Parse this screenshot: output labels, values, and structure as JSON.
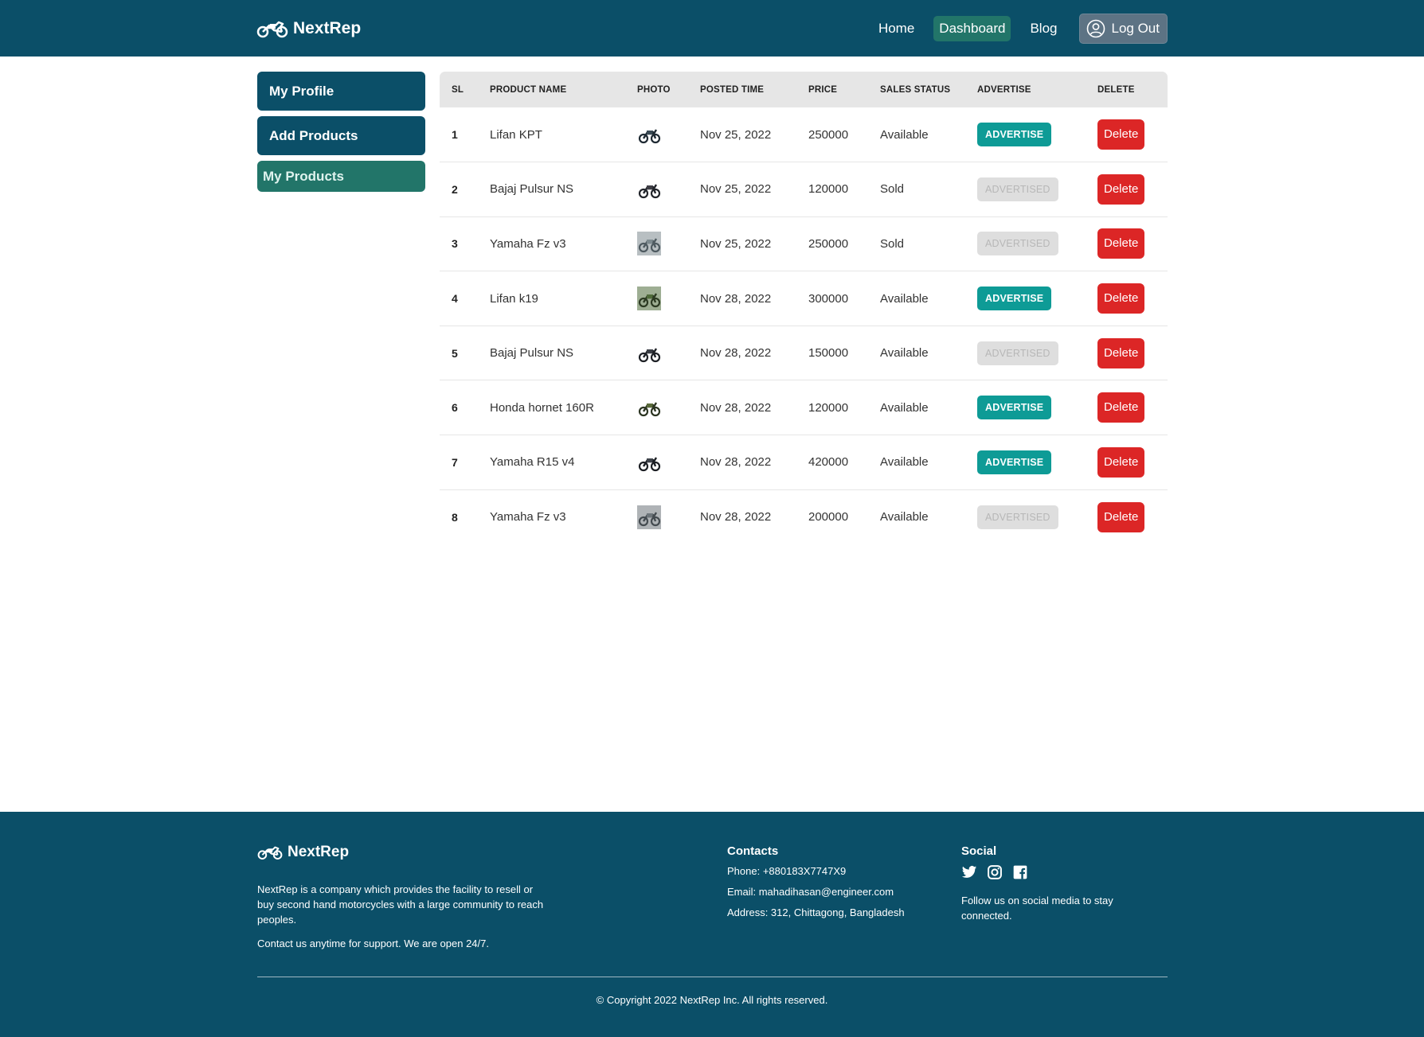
{
  "navbar": {
    "brand": "NextRep",
    "links": [
      "Home",
      "Dashboard",
      "Blog"
    ],
    "logout": "Log Out"
  },
  "sidebar": {
    "items": [
      "My Profile",
      "Add Products",
      "My Products"
    ],
    "active": "My Products"
  },
  "table": {
    "headers": [
      "SL",
      "PRODUCT NAME",
      "PHOTO",
      "POSTED TIME",
      "PRICE",
      "SALES STATUS",
      "ADVERTISE",
      "DELETE"
    ],
    "rows": [
      {
        "sl": "1",
        "name": "Lifan KPT",
        "photo": "motorcycle-photo",
        "time": "Nov 25, 2022",
        "price": "250000",
        "status": "Available",
        "advertise": "ADVERTISE",
        "delete": "Delete"
      },
      {
        "sl": "2",
        "name": "Bajaj Pulsur NS",
        "photo": "motorcycle-photo",
        "time": "Nov 25, 2022",
        "price": "120000",
        "status": "Sold",
        "advertise": "ADVERTISED",
        "delete": "Delete"
      },
      {
        "sl": "3",
        "name": "Yamaha Fz v3",
        "photo": "motorcycle-photo",
        "time": "Nov 25, 2022",
        "price": "250000",
        "status": "Sold",
        "advertise": "ADVERTISED",
        "delete": "Delete"
      },
      {
        "sl": "4",
        "name": "Lifan k19",
        "photo": "motorcycle-photo",
        "time": "Nov 28, 2022",
        "price": "300000",
        "status": "Available",
        "advertise": "ADVERTISE",
        "delete": "Delete"
      },
      {
        "sl": "5",
        "name": "Bajaj Pulsur NS",
        "photo": "motorcycle-photo",
        "time": "Nov 28, 2022",
        "price": "150000",
        "status": "Available",
        "advertise": "ADVERTISED",
        "delete": "Delete"
      },
      {
        "sl": "6",
        "name": "Honda hornet 160R",
        "photo": "motorcycle-photo",
        "time": "Nov 28, 2022",
        "price": "120000",
        "status": "Available",
        "advertise": "ADVERTISE",
        "delete": "Delete"
      },
      {
        "sl": "7",
        "name": "Yamaha R15 v4",
        "photo": "motorcycle-photo",
        "time": "Nov 28, 2022",
        "price": "420000",
        "status": "Available",
        "advertise": "ADVERTISE",
        "delete": "Delete"
      },
      {
        "sl": "8",
        "name": "Yamaha Fz v3",
        "photo": "motorcycle-photo",
        "time": "Nov 28, 2022",
        "price": "200000",
        "status": "Available",
        "advertise": "ADVERTISED",
        "delete": "Delete"
      }
    ]
  },
  "footer": {
    "brand": "NextRep",
    "about": "NextRep is a company which provides the facility to resell or buy second hand motorcycles with a large community to reach peoples.",
    "support": "Contact us anytime for support. We are open 24/7.",
    "contacts_title": "Contacts",
    "phone": "Phone: +880183X7747X9",
    "email": "Email: mahadihasan@engineer.com",
    "address": "Address: 312, Chittagong, Bangladesh",
    "social_title": "Social",
    "social_icons": [
      "twitter-icon",
      "instagram-icon",
      "facebook-icon"
    ],
    "follow": "Follow us on social media to stay connected.",
    "copyright": "© Copyright 2022 NextRep Inc. All rights reserved."
  },
  "colors": {
    "primary": "#0b4f68",
    "accent": "#227569",
    "advertise": "#0e9b96",
    "danger": "#dc2626"
  }
}
